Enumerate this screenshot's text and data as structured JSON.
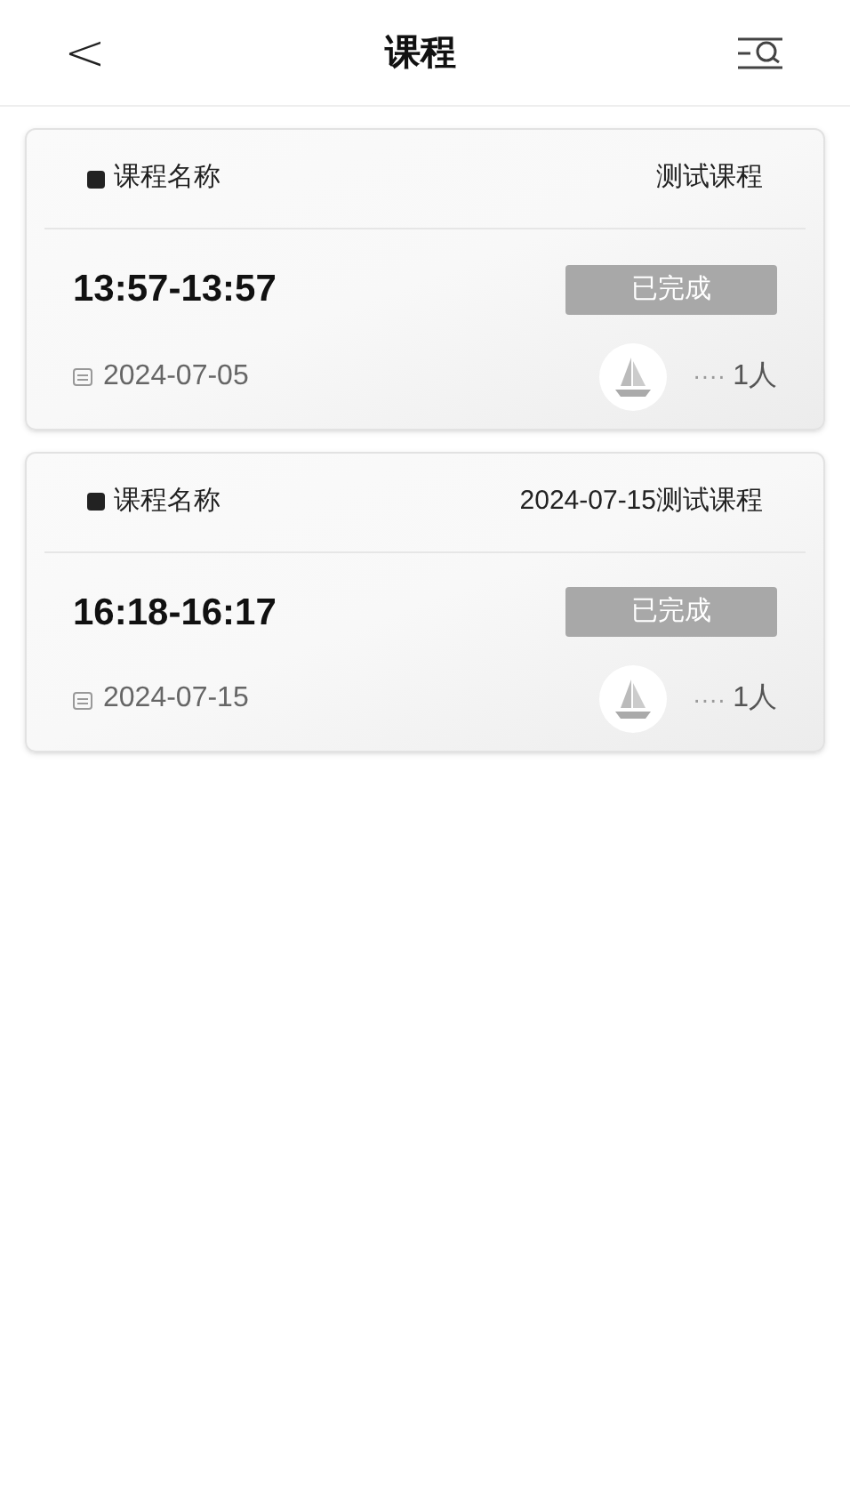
{
  "header": {
    "back": "<",
    "title": "课程"
  },
  "courses": [
    {
      "label": "课程名称",
      "name": "测试课程",
      "time": "13:57-13:57",
      "status": "已完成",
      "date": "2024-07-05",
      "dots": "····",
      "count": "1人"
    },
    {
      "label": "课程名称",
      "name": "2024-07-15测试课程",
      "time": "16:18-16:17",
      "status": "已完成",
      "date": "2024-07-15",
      "dots": "····",
      "count": "1人"
    }
  ]
}
